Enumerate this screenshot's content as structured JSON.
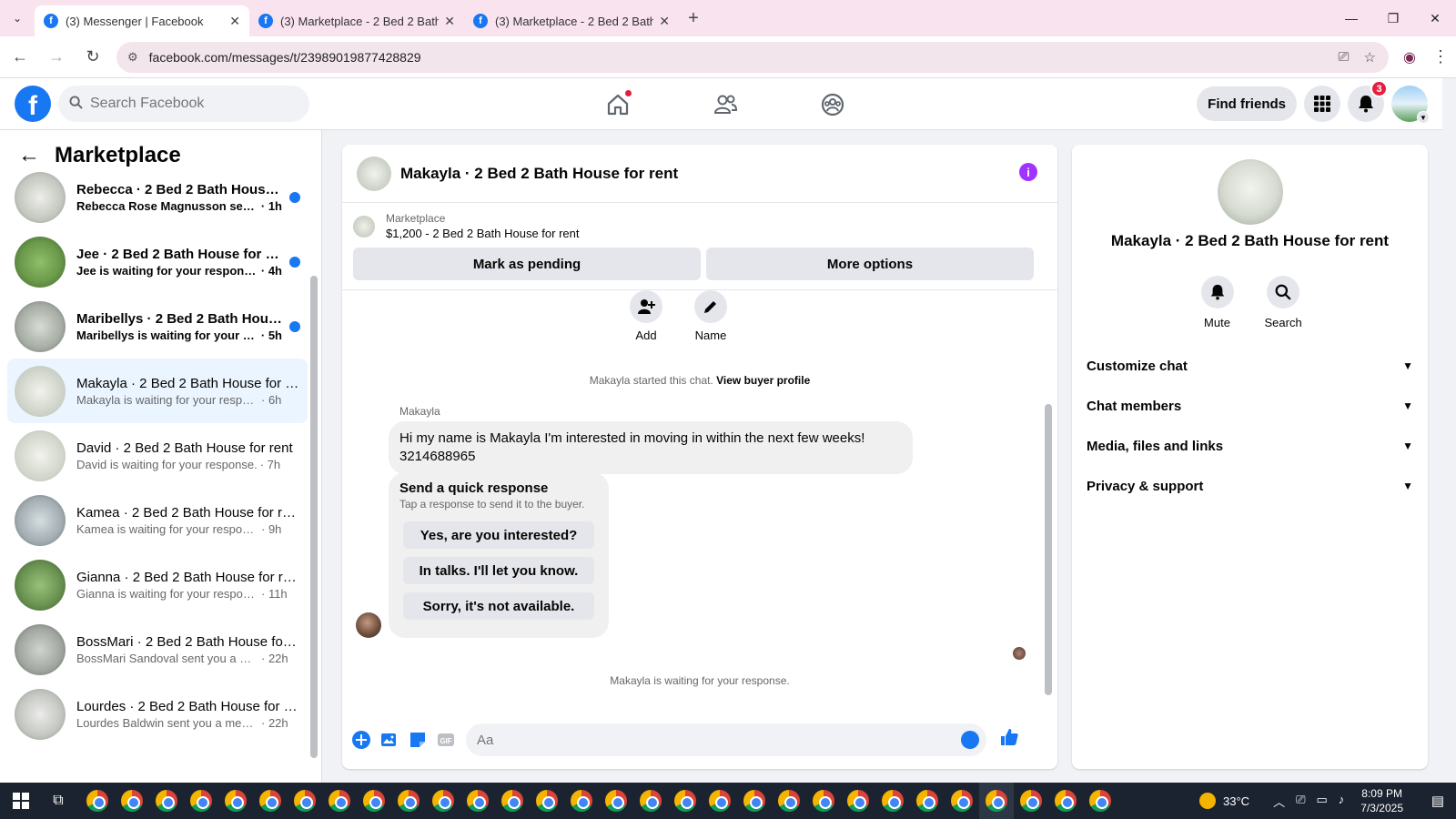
{
  "browser": {
    "tabs": [
      {
        "title": "(3) Messenger | Facebook",
        "active": true
      },
      {
        "title": "(3) Marketplace - 2 Bed 2 Bath House",
        "active": false
      },
      {
        "title": "(3) Marketplace - 2 Bed 2 Bath House",
        "active": false
      }
    ],
    "url": "facebook.com/messages/t/23989019877428829"
  },
  "header": {
    "search_placeholder": "Search Facebook",
    "find_friends": "Find friends",
    "notification_count": "3"
  },
  "sidebar": {
    "title": "Marketplace",
    "conversations": [
      {
        "name": "Rebecca · 2 Bed 2 Bath House for rent",
        "preview": "Rebecca Rose Magnusson sent you a message.",
        "time": "· 1h",
        "unread": true
      },
      {
        "name": "Jee · 2 Bed 2 Bath House for rent",
        "preview": "Jee is waiting for your response.",
        "time": "· 4h",
        "unread": true
      },
      {
        "name": "Maribellys · 2 Bed 2 Bath House for rent",
        "preview": "Maribellys is waiting for your response.",
        "time": "· 5h",
        "unread": true
      },
      {
        "name": "Makayla · 2 Bed 2 Bath House for rent",
        "preview": "Makayla is waiting for your response.",
        "time": "· 6h",
        "unread": false,
        "active": true
      },
      {
        "name": "David · 2 Bed 2 Bath House for rent",
        "preview": "David is waiting for your response.",
        "time": "· 7h",
        "unread": false
      },
      {
        "name": "Kamea · 2 Bed 2 Bath House for rent",
        "preview": "Kamea is waiting for your response.",
        "time": "· 9h",
        "unread": false
      },
      {
        "name": "Gianna · 2 Bed 2 Bath House for rent",
        "preview": "Gianna is waiting for your response.",
        "time": "· 11h",
        "unread": false
      },
      {
        "name": "BossMari · 2 Bed 2 Bath House for rent",
        "preview": "BossMari Sandoval sent you a message.",
        "time": "· 22h",
        "unread": false
      },
      {
        "name": "Lourdes · 2 Bed 2 Bath House for rent",
        "preview": "Lourdes Baldwin sent you a message.",
        "time": "· 22h",
        "unread": false
      }
    ]
  },
  "chat": {
    "title": "Makayla · 2 Bed 2 Bath House for rent",
    "listing_category": "Marketplace",
    "listing_price": "$1,200 - 2 Bed 2 Bath House for rent",
    "mark_pending": "Mark as pending",
    "more_options": "More options",
    "action_add": "Add",
    "action_name": "Name",
    "started_text": "Makayla started this chat.",
    "view_profile": "View buyer profile",
    "sender": "Makayla",
    "message": "Hi my name is Makayla I'm interested in moving in within the next few weeks! 3214688965",
    "quick_title": "Send a quick response",
    "quick_sub": "Tap a response to send it to the buyer.",
    "quick_options": [
      "Yes, are you interested?",
      "In talks. I'll let you know.",
      "Sorry, it's not available."
    ],
    "waiting": "Makayla is waiting for your response.",
    "composer_placeholder": "Aa"
  },
  "info": {
    "title": "Makayla · 2 Bed 2 Bath House for rent",
    "mute": "Mute",
    "search": "Search",
    "sections": [
      "Customize chat",
      "Chat members",
      "Media, files and links",
      "Privacy & support"
    ]
  },
  "taskbar": {
    "temperature": "33°C",
    "weather_badge": "1",
    "time": "8:09 PM",
    "date": "7/3/2025",
    "notification_badge": "1"
  },
  "colors": {
    "accent": "#1877f2",
    "info_purple": "#a033ff",
    "tab_bar": "#f9e3ee"
  }
}
